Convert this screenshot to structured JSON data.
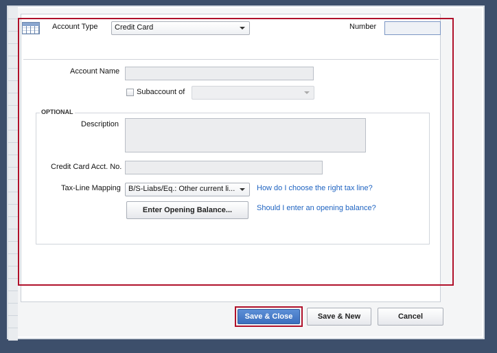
{
  "header": {
    "account_type_label": "Account Type",
    "account_type_value": "Credit Card",
    "number_label": "Number",
    "number_value": ""
  },
  "form": {
    "account_name_label": "Account Name",
    "account_name_value": "",
    "subaccount_label": "Subaccount of",
    "subaccount_checked": false,
    "subaccount_value": "",
    "optional_label": "OPTIONAL",
    "description_label": "Description",
    "description_value": "",
    "cc_acct_no_label": "Credit Card Acct. No.",
    "cc_acct_no_value": "",
    "tax_line_label": "Tax-Line Mapping",
    "tax_line_value": "B/S-Liabs/Eq.: Other current li...",
    "tax_line_help_link": "How do I choose the right tax line?",
    "opening_balance_button": "Enter Opening Balance...",
    "opening_balance_help_link": "Should I enter an opening balance?"
  },
  "footer": {
    "save_close_label": "Save & Close",
    "save_new_label": "Save & New",
    "cancel_label": "Cancel"
  },
  "colors": {
    "highlight": "#b0102a",
    "link": "#1e63c1",
    "primary_button": "#3b6fbe"
  }
}
